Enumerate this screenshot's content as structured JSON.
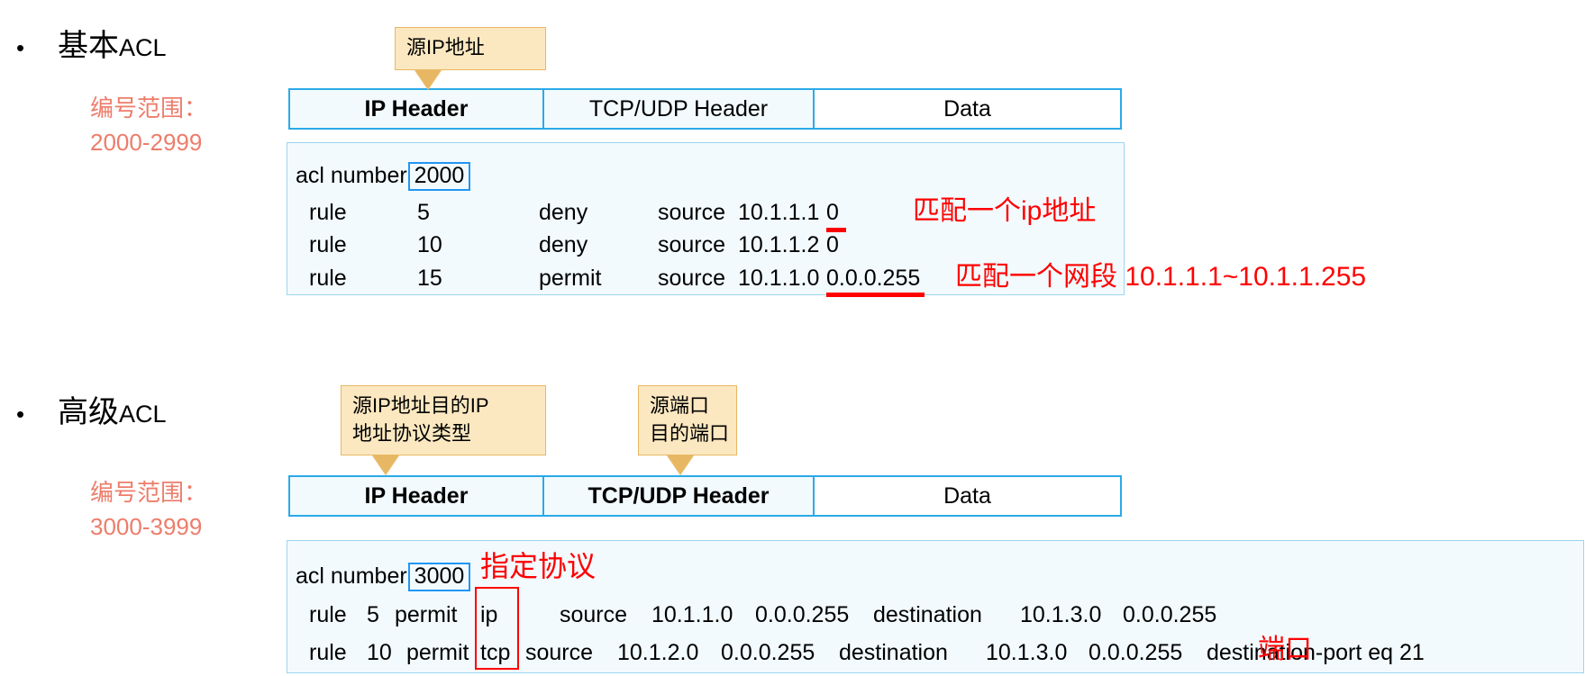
{
  "sections": [
    {
      "id": "basic-acl",
      "bullet": "•",
      "title_cn": "基本",
      "title_lat": "ACL",
      "range_label": "编号范围：",
      "range_value": "2000-2999",
      "callouts": [
        {
          "name": "source-ip-callout",
          "lines": [
            "源IP地址"
          ]
        }
      ],
      "packet": {
        "cells": [
          "IP Header",
          "TCP/UDP Header",
          "Data"
        ]
      },
      "acl": {
        "keyword": "acl number",
        "number": "2000",
        "rows": [
          {
            "rule": "rule",
            "id": "5",
            "action": "deny",
            "kw": "source",
            "ip": "10.1.1.1",
            "mask": "0"
          },
          {
            "rule": "rule",
            "id": "10",
            "action": "deny",
            "kw": "source",
            "ip": "10.1.1.2",
            "mask": "0"
          },
          {
            "rule": "rule",
            "id": "15",
            "action": "permit",
            "kw": "source",
            "ip": "10.1.1.0",
            "mask": "0.0.0.255"
          }
        ],
        "annotations": [
          {
            "name": "match-single-ip-note",
            "text": "匹配一个ip地址"
          },
          {
            "name": "match-subnet-note",
            "text": "匹配一个网段 10.1.1.1~10.1.1.255"
          }
        ]
      }
    },
    {
      "id": "advanced-acl",
      "bullet": "•",
      "title_cn": "高级",
      "title_lat": "ACL",
      "range_label": "编号范围：",
      "range_value": "3000-3999",
      "callouts": [
        {
          "name": "src-dst-ip-proto-callout",
          "lines": [
            "源IP地址目的IP",
            "地址协议类型"
          ]
        },
        {
          "name": "src-dst-port-callout",
          "lines": [
            "源端口",
            "目的端口"
          ]
        }
      ],
      "packet": {
        "cells": [
          "IP Header",
          "TCP/UDP Header",
          "Data"
        ]
      },
      "acl": {
        "keyword": "acl number",
        "number": "3000",
        "protocol_note": "指定协议",
        "port_note": "端口",
        "rows": [
          {
            "rule": "rule",
            "id": "5",
            "action": "permit",
            "proto": "ip",
            "src_kw": "source",
            "src_ip": "10.1.1.0",
            "src_mask": "0.0.0.255",
            "dst_kw": "destination",
            "dst_ip": "10.1.3.0",
            "dst_mask": "0.0.0.255",
            "port": ""
          },
          {
            "rule": "rule",
            "id": "10",
            "action": "permit",
            "proto": "tcp",
            "src_kw": "source",
            "src_ip": "10.1.2.0",
            "src_mask": "0.0.0.255",
            "dst_kw": "destination",
            "dst_ip": "10.1.3.0",
            "dst_mask": "0.0.0.255",
            "port": "destination-port eq 21"
          }
        ]
      }
    }
  ],
  "colors": {
    "accent_blue": "#2BAAE8",
    "box_fill": "#F2FAFE",
    "callout_fill": "#FCE8C0",
    "callout_border": "#E8B763",
    "salmon": "#ED7D6B",
    "red": "#FF0000",
    "num_box_blue": "#2196F3"
  }
}
